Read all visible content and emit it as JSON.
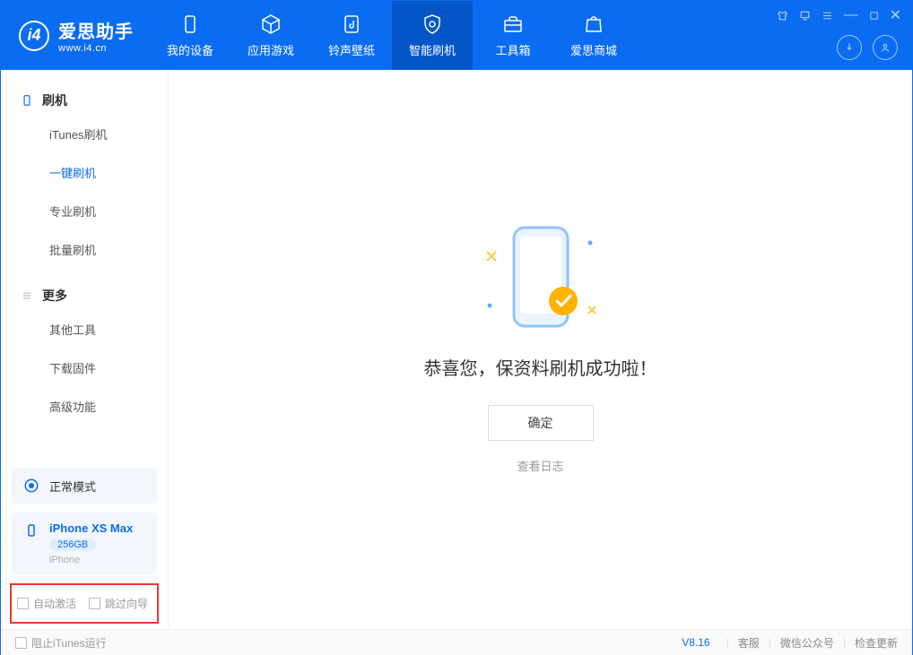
{
  "brand": {
    "name": "爱思助手",
    "url": "www.i4.cn"
  },
  "nav": {
    "device": "我的设备",
    "apps": "应用游戏",
    "ring": "铃声壁纸",
    "flash": "智能刷机",
    "tools": "工具箱",
    "store": "爱思商城"
  },
  "sidebar": {
    "group1": "刷机",
    "items1": {
      "itunes": "iTunes刷机",
      "oneclick": "一键刷机",
      "pro": "专业刷机",
      "batch": "批量刷机"
    },
    "group2": "更多",
    "items2": {
      "other": "其他工具",
      "firmware": "下载固件",
      "advanced": "高级功能"
    }
  },
  "mode": {
    "label": "正常模式"
  },
  "device": {
    "name": "iPhone XS Max",
    "storage": "256GB",
    "type": "iPhone"
  },
  "checks": {
    "auto_activate": "自动激活",
    "skip_guide": "跳过向导"
  },
  "main": {
    "success": "恭喜您，保资料刷机成功啦！",
    "ok": "确定",
    "log": "查看日志"
  },
  "footer": {
    "block_itunes": "阻止iTunes运行",
    "version": "V8.16",
    "support": "客服",
    "wechat": "微信公众号",
    "update": "检查更新"
  }
}
